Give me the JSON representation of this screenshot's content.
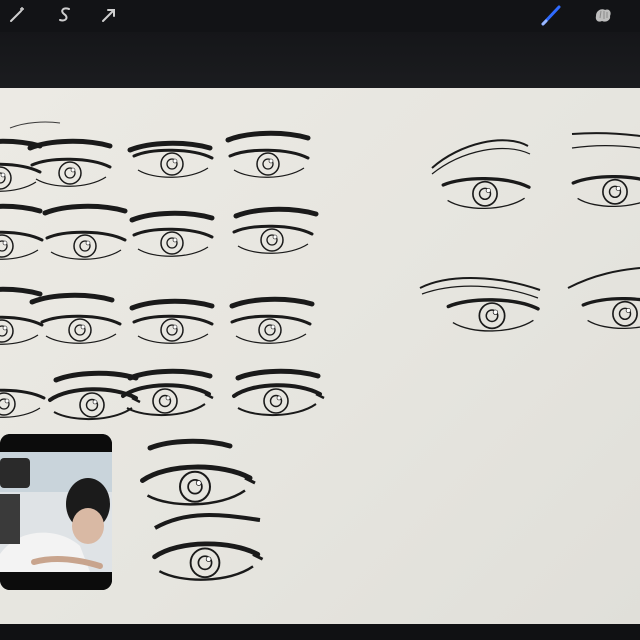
{
  "toolbar": {
    "left_tools": [
      "adjustments-wand-icon",
      "selection-s-icon",
      "transform-arrow-icon"
    ],
    "right_tools": [
      "brush-icon",
      "smudge-icon"
    ],
    "active_tool_color": "#2f6bff"
  },
  "canvas": {
    "background_color": "#e8e7e1",
    "ink_color": "#1a1a1a"
  },
  "video_overlay": {
    "content": "person-drawing-camera-feed"
  }
}
